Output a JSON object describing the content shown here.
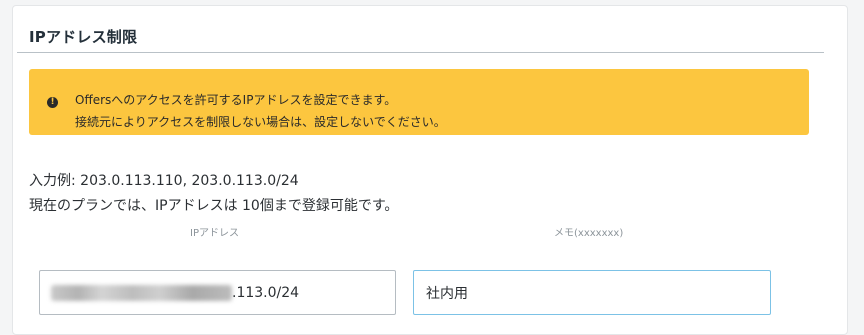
{
  "section": {
    "title": "IPアドレス制限"
  },
  "alert": {
    "icon": "exclamation-icon",
    "icon_glyph": "!",
    "line1": "Offersへのアクセスを許可するIPアドレスを設定できます。",
    "line2": "接続元によりアクセスを制限しない場合は、設定しないでください。",
    "background": "#fcc63f"
  },
  "info": {
    "example": "入力例: 203.0.113.110, 203.0.113.0/24",
    "plan_note": "現在のプランでは、IPアドレスは 10個まで登録可能です。"
  },
  "table": {
    "columns": [
      "IPアドレス",
      "メモ(xxxxxxx)"
    ],
    "rows": [
      {
        "ip_visible": ".113.0/24",
        "memo": "社内用"
      }
    ]
  },
  "colors": {
    "memo_focus_border": "#7cc2e6",
    "alert_bg": "#fcc63f"
  }
}
